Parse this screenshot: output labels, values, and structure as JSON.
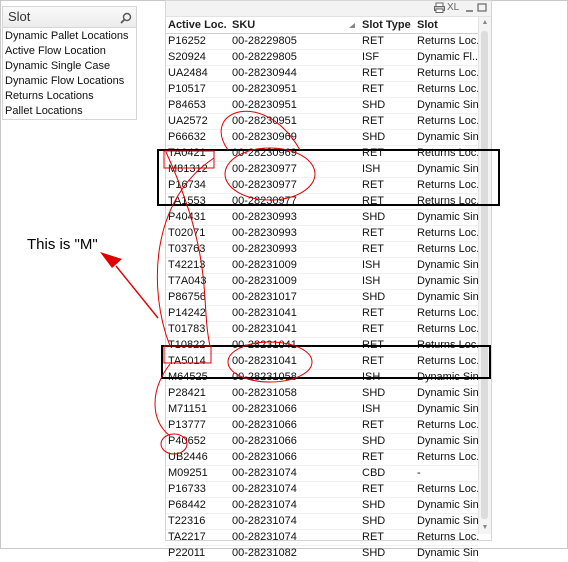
{
  "slot_listbox": {
    "title": "Slot",
    "search_icon": "search-icon",
    "items": [
      "Dynamic Pallet Locations",
      "Active Flow Location",
      "Dynamic Single Case",
      "Dynamic Flow Locations",
      "Returns Locations",
      "Pallet Locations"
    ]
  },
  "table": {
    "caption_buttons": [
      "print-icon",
      "XL",
      "minimize-icon",
      "maximize-icon"
    ],
    "caption_xl": "XL",
    "columns": [
      "Active Loc.",
      "SKU",
      "Slot Type",
      "Slot"
    ],
    "rows": [
      [
        "P16252",
        "00-28229805",
        "RET",
        "Returns Loc."
      ],
      [
        "S20924",
        "00-28229805",
        "ISF",
        "Dynamic Fl..."
      ],
      [
        "UA2484",
        "00-28230944",
        "RET",
        "Returns Loc."
      ],
      [
        "P10517",
        "00-28230951",
        "RET",
        "Returns Loc."
      ],
      [
        "P84653",
        "00-28230951",
        "SHD",
        "Dynamic Sin..."
      ],
      [
        "UA2572",
        "00-28230951",
        "RET",
        "Returns Loc."
      ],
      [
        "P66632",
        "00-28230969",
        "SHD",
        "Dynamic Sin..."
      ],
      [
        "TA0421",
        "00-28230969",
        "RET",
        "Returns Loc."
      ],
      [
        "M81312",
        "00-28230977",
        "ISH",
        "Dynamic Sin..."
      ],
      [
        "P16734",
        "00-28230977",
        "RET",
        "Returns Loc."
      ],
      [
        "TA1553",
        "00-28230977",
        "RET",
        "Returns Loc."
      ],
      [
        "P40431",
        "00-28230993",
        "SHD",
        "Dynamic Sin..."
      ],
      [
        "T02071",
        "00-28230993",
        "RET",
        "Returns Loc."
      ],
      [
        "T03763",
        "00-28230993",
        "RET",
        "Returns Loc."
      ],
      [
        "T42213",
        "00-28231009",
        "ISH",
        "Dynamic Sin..."
      ],
      [
        "T7A043",
        "00-28231009",
        "ISH",
        "Dynamic Sin..."
      ],
      [
        "P86756",
        "00-28231017",
        "SHD",
        "Dynamic Sin..."
      ],
      [
        "P14242",
        "00-28231041",
        "RET",
        "Returns Loc."
      ],
      [
        "T01783",
        "00-28231041",
        "RET",
        "Returns Loc."
      ],
      [
        "T10822",
        "00-28231041",
        "RET",
        "Returns Loc."
      ],
      [
        "TA5014",
        "00-28231041",
        "RET",
        "Returns Loc."
      ],
      [
        "M64525",
        "00-28231058",
        "ISH",
        "Dynamic Sin..."
      ],
      [
        "P28421",
        "00-28231058",
        "SHD",
        "Dynamic Sin..."
      ],
      [
        "M71151",
        "00-28231066",
        "ISH",
        "Dynamic Sin..."
      ],
      [
        "P13777",
        "00-28231066",
        "RET",
        "Returns Loc."
      ],
      [
        "P40652",
        "00-28231066",
        "SHD",
        "Dynamic Sin..."
      ],
      [
        "UB2446",
        "00-28231066",
        "RET",
        "Returns Loc."
      ],
      [
        "M09251",
        "00-28231074",
        "CBD",
        "-"
      ],
      [
        "P16733",
        "00-28231074",
        "RET",
        "Returns Loc."
      ],
      [
        "P68442",
        "00-28231074",
        "SHD",
        "Dynamic Sin..."
      ],
      [
        "T22316",
        "00-28231074",
        "SHD",
        "Dynamic Sin..."
      ],
      [
        "TA2217",
        "00-28231074",
        "RET",
        "Returns Loc."
      ],
      [
        "P22011",
        "00-28231082",
        "SHD",
        "Dynamic Sin..."
      ]
    ]
  },
  "annotation": {
    "text": "This is \"M\"",
    "color": "#e00000"
  }
}
